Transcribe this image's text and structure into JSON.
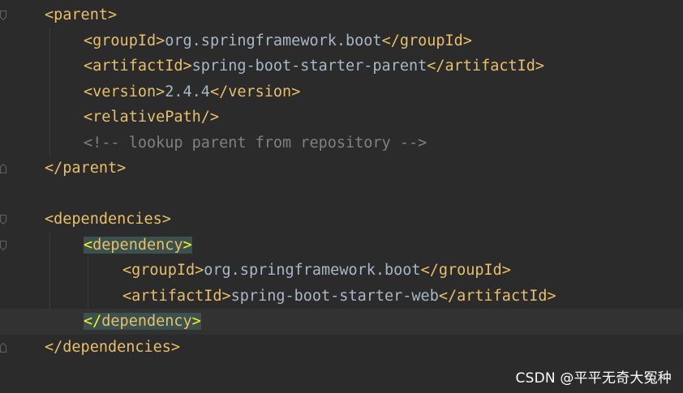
{
  "editor": {
    "lines": [
      {
        "open": "<parent>",
        "text": "",
        "close": ""
      },
      {
        "open": "<groupId>",
        "text": "org.springframework.boot",
        "close": "</groupId>"
      },
      {
        "open": "<artifactId>",
        "text": "spring-boot-starter-parent",
        "close": "</artifactId>"
      },
      {
        "open": "<version>",
        "text": "2.4.4",
        "close": "</version>"
      },
      {
        "open": "<relativePath/>",
        "text": "",
        "close": ""
      },
      {
        "comment": "<!-- lookup parent from repository -->"
      },
      {
        "open": "</parent>",
        "text": "",
        "close": ""
      },
      {
        "open": "",
        "text": "",
        "close": ""
      },
      {
        "open": "<dependencies>",
        "text": "",
        "close": ""
      },
      {
        "hl_lt": "<",
        "hl_name": "dependency",
        "hl_gt": ">"
      },
      {
        "open": "<groupId>",
        "text": "org.springframework.boot",
        "close": "</groupId>"
      },
      {
        "open": "<artifactId>",
        "text": "spring-boot-starter-web",
        "close": "</artifactId>"
      },
      {
        "hl_lt": "</",
        "hl_name": "dependency",
        "hl_gt": ">"
      },
      {
        "open": "</dependencies>",
        "text": "",
        "close": ""
      }
    ]
  },
  "watermark": "CSDN @平平无奇大冤种",
  "colors": {
    "background": "#2b2b2b",
    "tag": "#e8bf6a",
    "text": "#a9b7c6",
    "comment": "#808080",
    "match_highlight": "#3b514d",
    "current_line": "#323232"
  }
}
